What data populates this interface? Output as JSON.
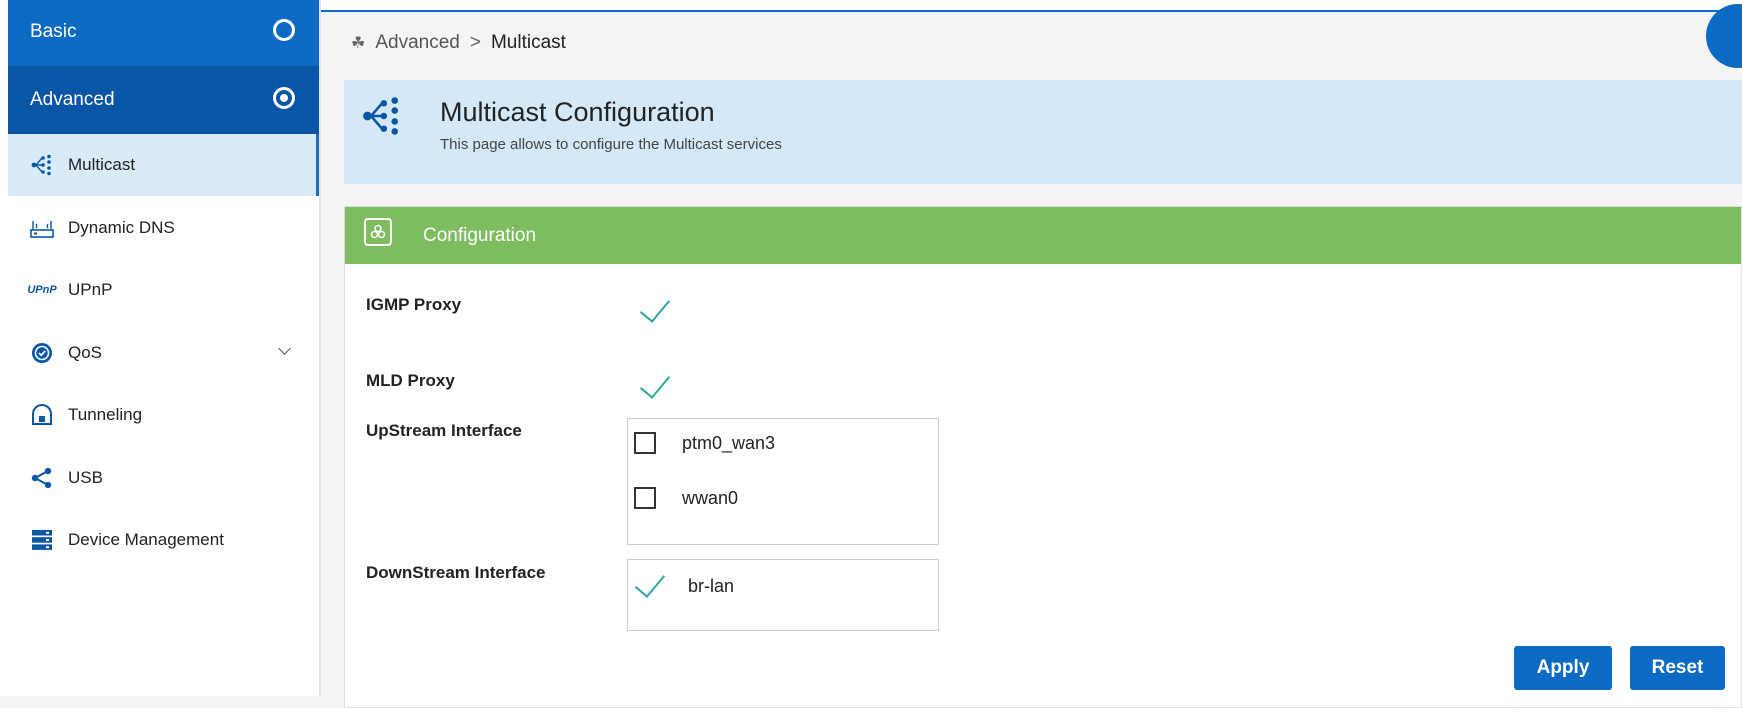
{
  "sidebar": {
    "basic_label": "Basic",
    "advanced_label": "Advanced",
    "items": [
      {
        "label": "Multicast",
        "icon": "multicast-icon"
      },
      {
        "label": "Dynamic DNS",
        "icon": "router-icon"
      },
      {
        "label": "UPnP",
        "icon": "upnp-icon"
      },
      {
        "label": "QoS",
        "icon": "qos-badge-icon"
      },
      {
        "label": "Tunneling",
        "icon": "tunnel-icon"
      },
      {
        "label": "USB",
        "icon": "share-icon"
      },
      {
        "label": "Device Management",
        "icon": "server-icon"
      }
    ]
  },
  "breadcrumb": {
    "parent": "Advanced",
    "separator": ">",
    "current": "Multicast"
  },
  "header": {
    "title": "Multicast Configuration",
    "subtitle": "This page allows to configure the Multicast services"
  },
  "config": {
    "panel_title": "Configuration",
    "igmp_label": "IGMP Proxy",
    "igmp_checked": true,
    "mld_label": "MLD Proxy",
    "mld_checked": true,
    "upstream_label": "UpStream Interface",
    "upstream_options": [
      {
        "name": "ptm0_wan3",
        "checked": false
      },
      {
        "name": "wwan0",
        "checked": false
      }
    ],
    "downstream_label": "DownStream Interface",
    "downstream_options": [
      {
        "name": "br-lan",
        "checked": true
      }
    ]
  },
  "buttons": {
    "apply": "Apply",
    "reset": "Reset"
  },
  "colors": {
    "primary": "#0b6bc4",
    "primary_dark": "#0a56a6",
    "active_bg": "#d9ebf9",
    "header_bg": "#d4e8f8",
    "panel_green": "#7dbd60",
    "check_teal": "#2aa89a"
  }
}
